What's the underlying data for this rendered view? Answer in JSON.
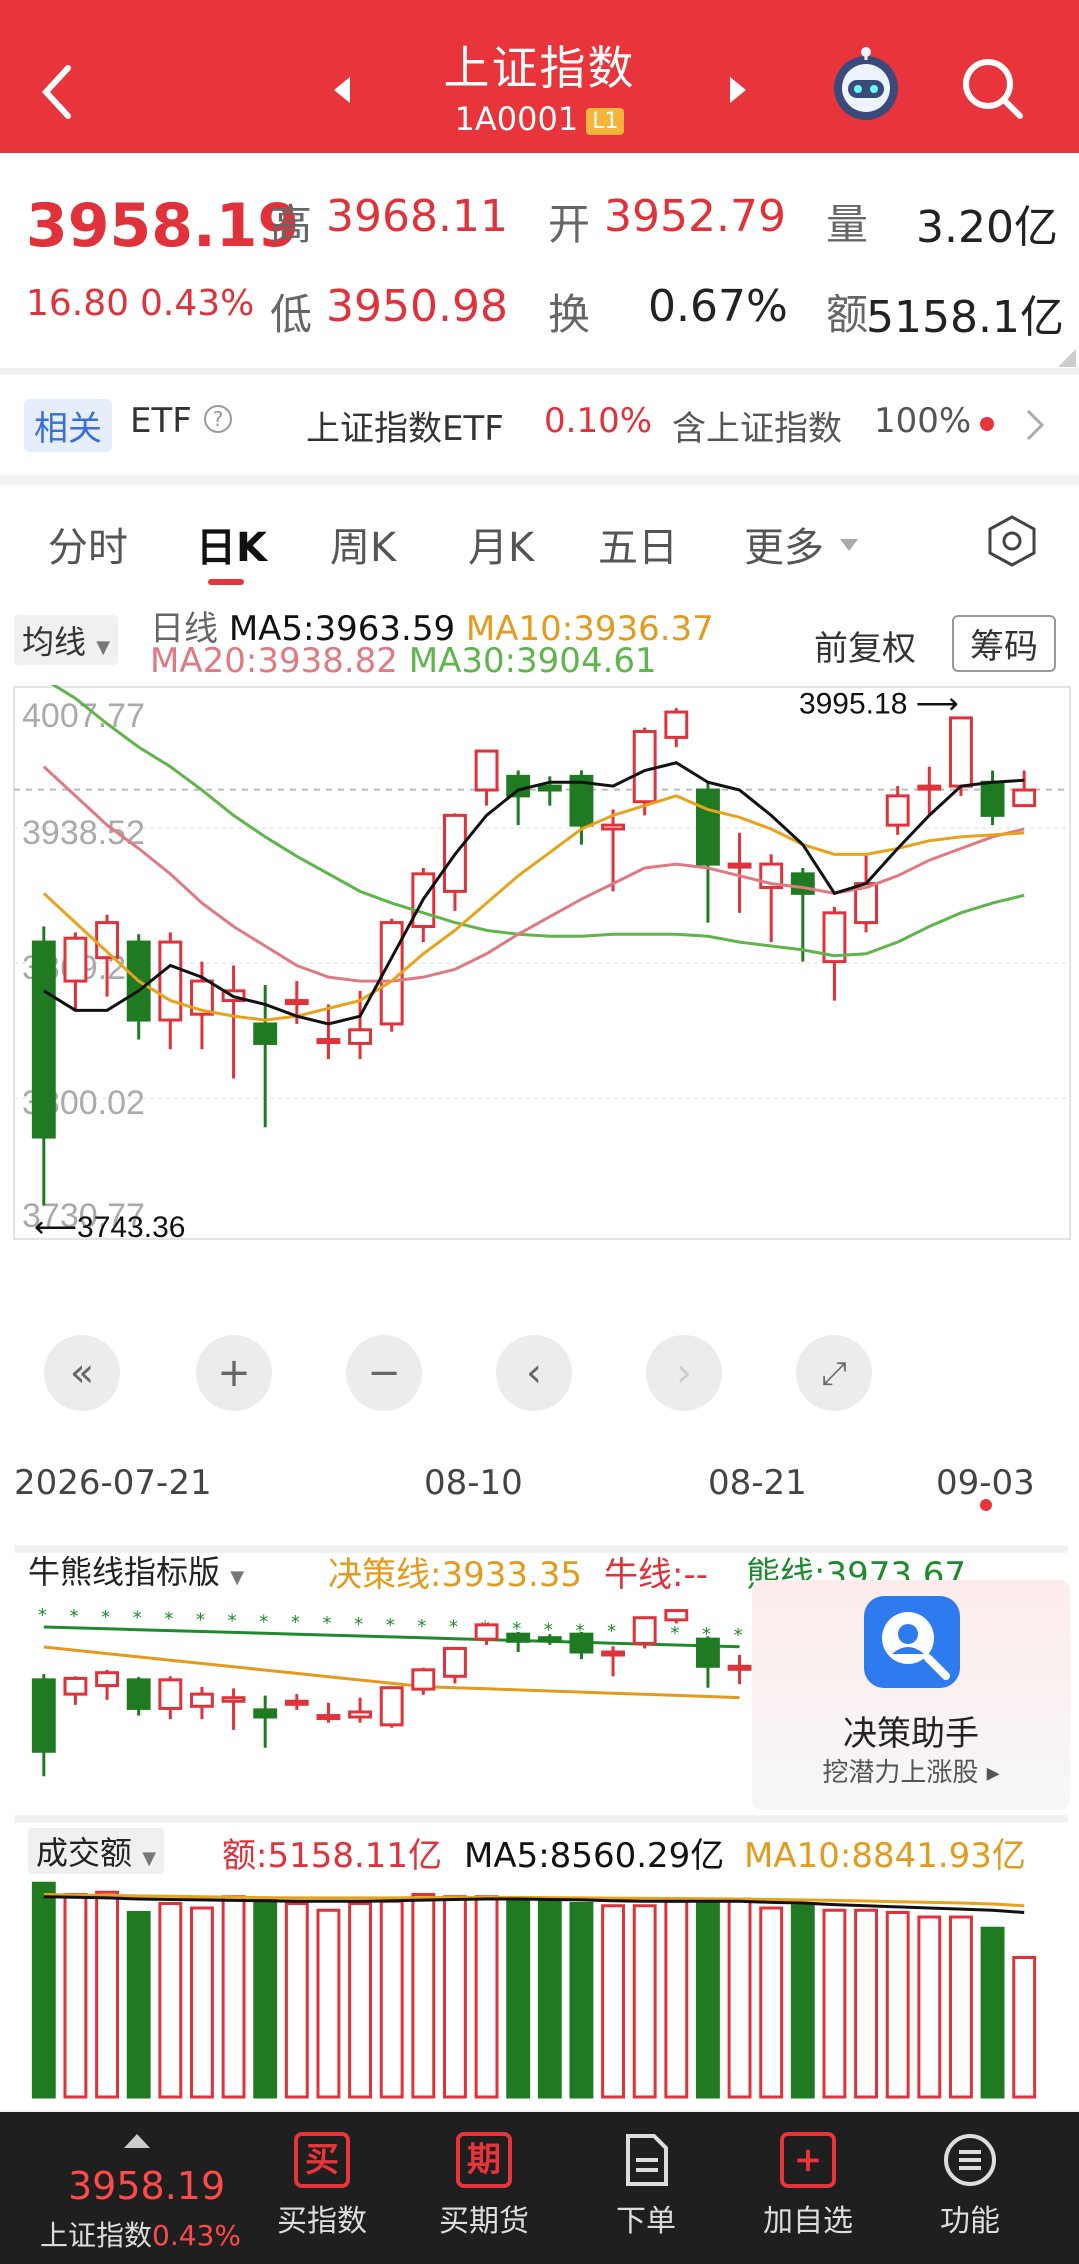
{
  "header": {
    "title": "上证指数",
    "code": "1A0001",
    "level": "L1"
  },
  "quote": {
    "price": "3958.19",
    "change": "16.80",
    "change_pct": "0.43%",
    "high_label": "高",
    "high": "3968.11",
    "low_label": "低",
    "low": "3950.98",
    "open_label": "开",
    "open": "3952.79",
    "turnover_label": "换",
    "turnover": "0.67%",
    "volume_label": "量",
    "volume": "3.20亿",
    "amount_label": "额",
    "amount": "5158.1亿"
  },
  "etf": {
    "tag": "相关",
    "tag2": "ETF",
    "name": "上证指数ETF",
    "pct": "0.10%",
    "contains": "含上证指数",
    "ratio": "100%"
  },
  "tabs": [
    "分时",
    "日K",
    "周K",
    "月K",
    "五日",
    "更多"
  ],
  "ma": {
    "selector": "均线",
    "title": "日线",
    "ma5": "MA5:3963.59",
    "ma10": "MA10:3936.37",
    "ma20": "MA20:3938.82",
    "ma30": "MA30:3904.61",
    "adjust": "前复权",
    "chips": "筹码"
  },
  "axis": {
    "y": [
      "4007.77",
      "3938.52",
      "3869.27",
      "3800.02",
      "3730.77"
    ],
    "x": [
      "2026-07-21",
      "08-10",
      "08-21",
      "09-03"
    ],
    "high_mark": "3995.18",
    "low_mark": "3743.36"
  },
  "indicator": {
    "selector": "牛熊线指标版",
    "decision": "决策线:3933.35",
    "bull": "牛线:--",
    "bear": "熊线:3973.67",
    "assistant": "决策助手",
    "assistant_sub": "挖潜力上涨股"
  },
  "volume": {
    "selector": "成交额",
    "amount": "额:5158.11亿",
    "ma5": "MA5:8560.29亿",
    "ma10": "MA10:8841.93亿"
  },
  "bottom": {
    "price": "3958.19",
    "name": "上证指数",
    "pct": "0.43%",
    "items": [
      "买指数",
      "买期货",
      "下单",
      "加自选",
      "功能"
    ],
    "icon_buy": "买",
    "icon_fut": "期",
    "icon_add": "+"
  },
  "colors": {
    "up": "#e0323a",
    "down": "#1f7a22",
    "ma5": "#111111",
    "ma10": "#e8a21c",
    "ma20": "#e07a82",
    "ma30": "#5fb44b"
  },
  "chart_data": {
    "type": "candlestick",
    "candles": [
      [
        3880,
        3780,
        3888,
        3745
      ],
      [
        3860,
        3882,
        3885,
        3845
      ],
      [
        3872,
        3890,
        3894,
        3852
      ],
      [
        3880,
        3840,
        3884,
        3830
      ],
      [
        3840,
        3880,
        3885,
        3825
      ],
      [
        3843,
        3860,
        3870,
        3825
      ],
      [
        3850,
        3855,
        3868,
        3810
      ],
      [
        3838,
        3828,
        3858,
        3785
      ],
      [
        3850,
        3850,
        3860,
        3838
      ],
      [
        3830,
        3830,
        3848,
        3820
      ],
      [
        3828,
        3835,
        3855,
        3820
      ],
      [
        3838,
        3890,
        3892,
        3834
      ],
      [
        3888,
        3915,
        3918,
        3880
      ],
      [
        3906,
        3945,
        3946,
        3896
      ],
      [
        3958,
        3978,
        3978,
        3950
      ],
      [
        3965,
        3955,
        3968,
        3940
      ],
      [
        3960,
        3958,
        3965,
        3950
      ],
      [
        3965,
        3940,
        3968,
        3930
      ],
      [
        3938,
        3940,
        3948,
        3906
      ],
      [
        3952,
        3988,
        3990,
        3945
      ],
      [
        3985,
        3998,
        4000,
        3980
      ],
      [
        3958,
        3920,
        3962,
        3890
      ],
      [
        3920,
        3920,
        3936,
        3895
      ],
      [
        3908,
        3920,
        3925,
        3880
      ],
      [
        3915,
        3905,
        3918,
        3870
      ],
      [
        3870,
        3895,
        3898,
        3850
      ],
      [
        3890,
        3910,
        3925,
        3885
      ],
      [
        3940,
        3955,
        3960,
        3935
      ],
      [
        3960,
        3960,
        3970,
        3945
      ],
      [
        3960,
        3995,
        3995,
        3955
      ],
      [
        3962,
        3945,
        3968,
        3940
      ],
      [
        3950,
        3958,
        3968,
        3950
      ]
    ],
    "ma5": [
      3855,
      3845,
      3845,
      3855,
      3868,
      3862,
      3852,
      3848,
      3842,
      3838,
      3842,
      3872,
      3902,
      3925,
      3945,
      3958,
      3962,
      3962,
      3960,
      3968,
      3972,
      3962,
      3958,
      3945,
      3930,
      3905,
      3910,
      3928,
      3945,
      3960,
      3962,
      3963
    ],
    "ma10": [
      3905,
      3890,
      3875,
      3860,
      3850,
      3845,
      3842,
      3840,
      3842,
      3846,
      3850,
      3860,
      3874,
      3886,
      3900,
      3914,
      3926,
      3938,
      3945,
      3950,
      3955,
      3948,
      3944,
      3938,
      3930,
      3925,
      3925,
      3928,
      3932,
      3934,
      3935,
      3936
    ],
    "ma20": [
      3970,
      3955,
      3940,
      3928,
      3915,
      3900,
      3888,
      3878,
      3868,
      3862,
      3860,
      3860,
      3862,
      3866,
      3874,
      3884,
      3893,
      3902,
      3910,
      3918,
      3920,
      3918,
      3914,
      3910,
      3908,
      3905,
      3908,
      3914,
      3922,
      3928,
      3934,
      3938
    ],
    "ma30": [
      4015,
      4005,
      3992,
      3980,
      3970,
      3958,
      3945,
      3934,
      3924,
      3915,
      3906,
      3900,
      3895,
      3890,
      3886,
      3884,
      3883,
      3883,
      3884,
      3884,
      3884,
      3883,
      3880,
      3878,
      3876,
      3873,
      3874,
      3880,
      3888,
      3895,
      3900,
      3904
    ],
    "volume": [
      9500,
      9000,
      9100,
      8200,
      8600,
      8400,
      8900,
      8800,
      8600,
      8300,
      8600,
      8700,
      9000,
      8900,
      8900,
      8800,
      8700,
      8600,
      8500,
      8500,
      8700,
      8800,
      8800,
      8400,
      8500,
      8300,
      8300,
      8200,
      8000,
      8000,
      7500,
      6200
    ],
    "volume_ma5": [
      8900,
      8880,
      8850,
      8800,
      8780,
      8760,
      8740,
      8720,
      8700,
      8700,
      8700,
      8720,
      8750,
      8780,
      8800,
      8800,
      8780,
      8760,
      8720,
      8700,
      8700,
      8700,
      8700,
      8650,
      8620,
      8550,
      8500,
      8450,
      8400,
      8350,
      8300,
      8200
    ],
    "volume_ma10": [
      9000,
      8980,
      8960,
      8940,
      8920,
      8900,
      8880,
      8860,
      8850,
      8850,
      8850,
      8850,
      8860,
      8860,
      8870,
      8870,
      8860,
      8850,
      8840,
      8830,
      8820,
      8810,
      8800,
      8780,
      8760,
      8740,
      8710,
      8680,
      8650,
      8620,
      8580,
      8500
    ],
    "ylim": [
      3730.77,
      4007.77
    ]
  }
}
